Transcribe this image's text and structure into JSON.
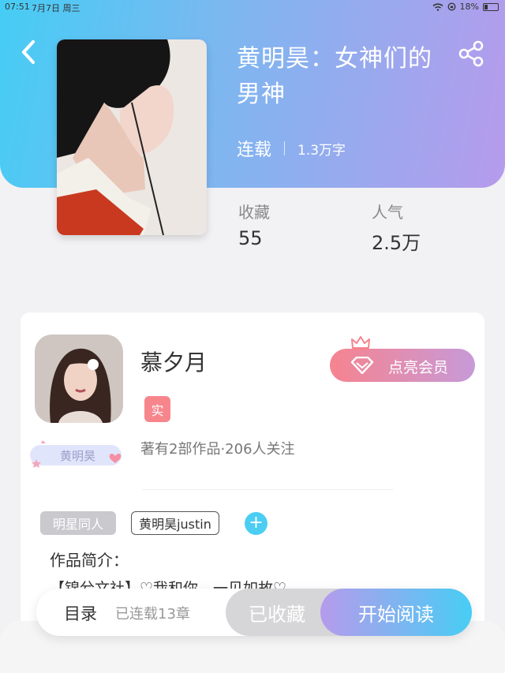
{
  "status_bar": {
    "time": "07:51",
    "date": "7月7日 周三",
    "battery": "18%"
  },
  "book": {
    "title": "黄明昊：女神们的男神",
    "status": "连载",
    "word_count": "1.3万字",
    "stats": [
      {
        "label": "收藏",
        "value": "55"
      },
      {
        "label": "人气",
        "value": "2.5万"
      }
    ]
  },
  "author": {
    "name": "慕夕月",
    "verified_badge": "实",
    "meta": "著有2部作品·206人关注",
    "fan_badge": "黄明昊",
    "vip_button": "点亮会员"
  },
  "tags": [
    "明星同人",
    "黄明昊justin"
  ],
  "tag_add": "+",
  "intro": {
    "title": "作品简介：",
    "text": "【锦兮文社】♡我和你，一见如故♡"
  },
  "bottom_bar": {
    "toc": "目录",
    "chapters": "已连载13章",
    "favorited": "已收藏",
    "read": "开始阅读"
  },
  "colors": {
    "header_gradient_start": "#45cdf5",
    "header_gradient_end": "#b69bec",
    "accent_blue": "#4ccdf3",
    "vip_pink": "#f6838f"
  },
  "icons": [
    "back-arrow-icon",
    "share-icon",
    "wifi-icon",
    "battery-icon",
    "crown-icon",
    "diamond-icon",
    "plus-icon"
  ]
}
